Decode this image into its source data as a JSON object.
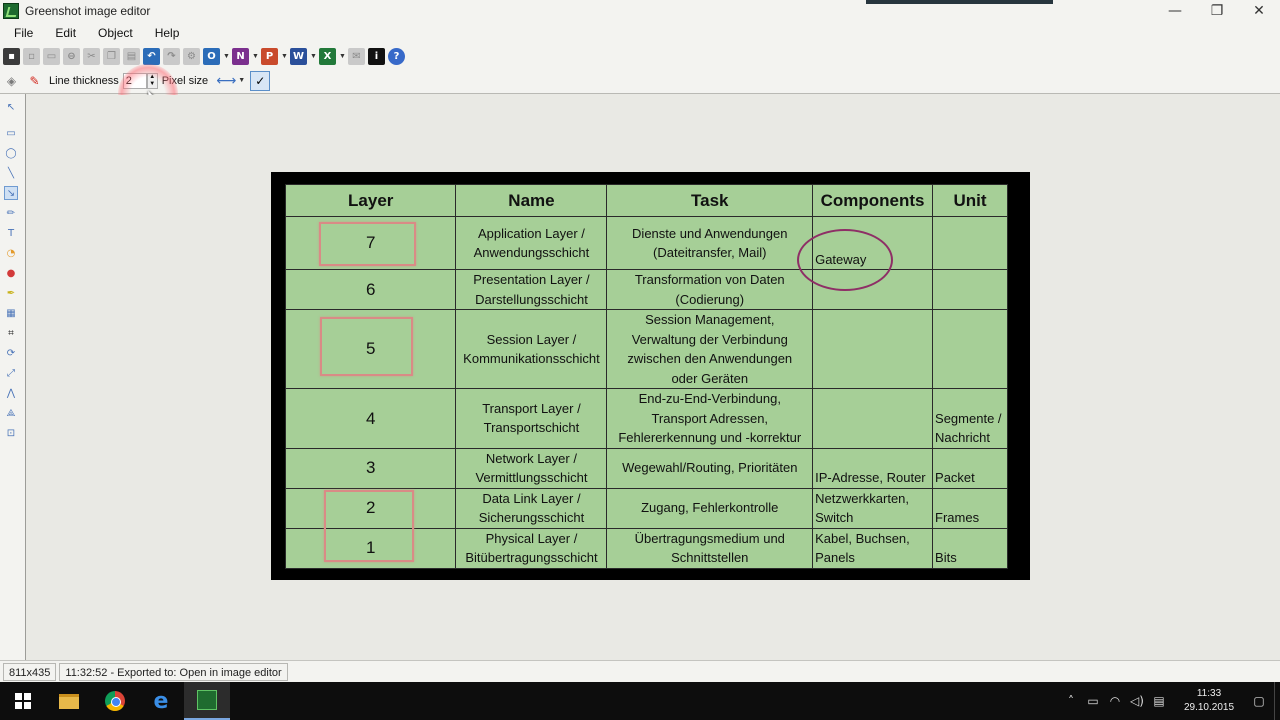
{
  "window": {
    "title": "Greenshot image editor",
    "controls": {
      "minimize": "—",
      "maximize": "❐",
      "close": "✕"
    }
  },
  "menu": [
    "File",
    "Edit",
    "Object",
    "Help"
  ],
  "toolbar": {
    "icons": [
      "save-icon",
      "clipboard-icon",
      "print-icon",
      "delete-icon",
      "cut-icon",
      "copy-icon",
      "paste-icon",
      "undo-icon",
      "redo-icon",
      "settings-icon",
      "outlook-icon",
      "onenote-icon",
      "powerpoint-icon",
      "word-icon",
      "excel-icon",
      "imgur-icon",
      "info-icon",
      "help-icon"
    ]
  },
  "properties": {
    "line_thickness_label": "Line thickness",
    "line_thickness_value": "2",
    "pixel_size_label": "Pixel size"
  },
  "tools": [
    "select-tool",
    "rectangle-tool",
    "ellipse-tool",
    "line-tool",
    "arrow-tool",
    "freehand-tool",
    "text-tool",
    "speechbubble-tool",
    "counter-tool",
    "highlight-tool",
    "obfuscate-tool",
    "crop-tool",
    "rotate-cw-tool",
    "rotate-ccw-tool",
    "resize-tool",
    "torn-edge-tool",
    "border-tool"
  ],
  "image_table": {
    "headers": [
      "Layer",
      "Name",
      "Task",
      "Components",
      "Unit"
    ],
    "rows": [
      {
        "layer": "7",
        "name1": "Application Layer /",
        "name2": "Anwendungsschicht",
        "task1": "Dienste und Anwendungen",
        "task2": "(Dateitransfer, Mail)",
        "task3": "",
        "task4": "",
        "components": "Gateway",
        "unit": ""
      },
      {
        "layer": "6",
        "name1": "Presentation Layer /",
        "name2": "Darstellungsschicht",
        "task1": "Transformation von Daten",
        "task2": "(Codierung)",
        "task3": "",
        "task4": "",
        "components": "",
        "unit": ""
      },
      {
        "layer": "5",
        "name1": "Session Layer /",
        "name2": "Kommunikationsschicht",
        "task1": "Session Management,",
        "task2": "Verwaltung der Verbindung",
        "task3": "zwischen den Anwendungen",
        "task4": "oder Geräten",
        "components": "",
        "unit": ""
      },
      {
        "layer": "4",
        "name1": "Transport Layer /",
        "name2": "Transportschicht",
        "task1": "End-zu-End-Verbindung,",
        "task2": "Transport Adressen,",
        "task3": "Fehlererkennung und -korrektur",
        "task4": "",
        "components": "",
        "unit1": "Segmente /",
        "unit2": "Nachricht"
      },
      {
        "layer": "3",
        "name1": "Network Layer /",
        "name2": "Vermittlungsschicht",
        "task1": "Wegewahl/Routing, Prioritäten",
        "task2": "",
        "task3": "",
        "task4": "",
        "components": "IP-Adresse, Router",
        "unit": "Packet"
      },
      {
        "layer": "2",
        "name1": "Data Link Layer /",
        "name2": "Sicherungsschicht",
        "task1": "Zugang, Fehlerkontrolle",
        "task2": "",
        "task3": "",
        "task4": "",
        "components1": "Netzwerkkarten,",
        "components2": "Switch",
        "unit": "Frames"
      },
      {
        "layer": "1",
        "name1": "Physical Layer /",
        "name2": "Bitübertragungsschicht",
        "task1": "Übertragungsmedium und",
        "task2": "Schnittstellen",
        "task3": "",
        "task4": "",
        "components1": "Kabel, Buchsen,",
        "components2": "Panels",
        "unit": "Bits"
      }
    ]
  },
  "annotation_colors": {
    "box": "#d98b86",
    "ellipse": "#8e2f66",
    "table_bg": "#a6cf97"
  },
  "status": {
    "dimensions": "811x435",
    "message": "11:32:52 - Exported to: Open in image editor"
  },
  "taskbar": {
    "apps": [
      "file-explorer-icon",
      "chrome-icon",
      "edge-icon",
      "greenshot-icon"
    ],
    "time": "11:33",
    "date": "29.10.2015"
  }
}
